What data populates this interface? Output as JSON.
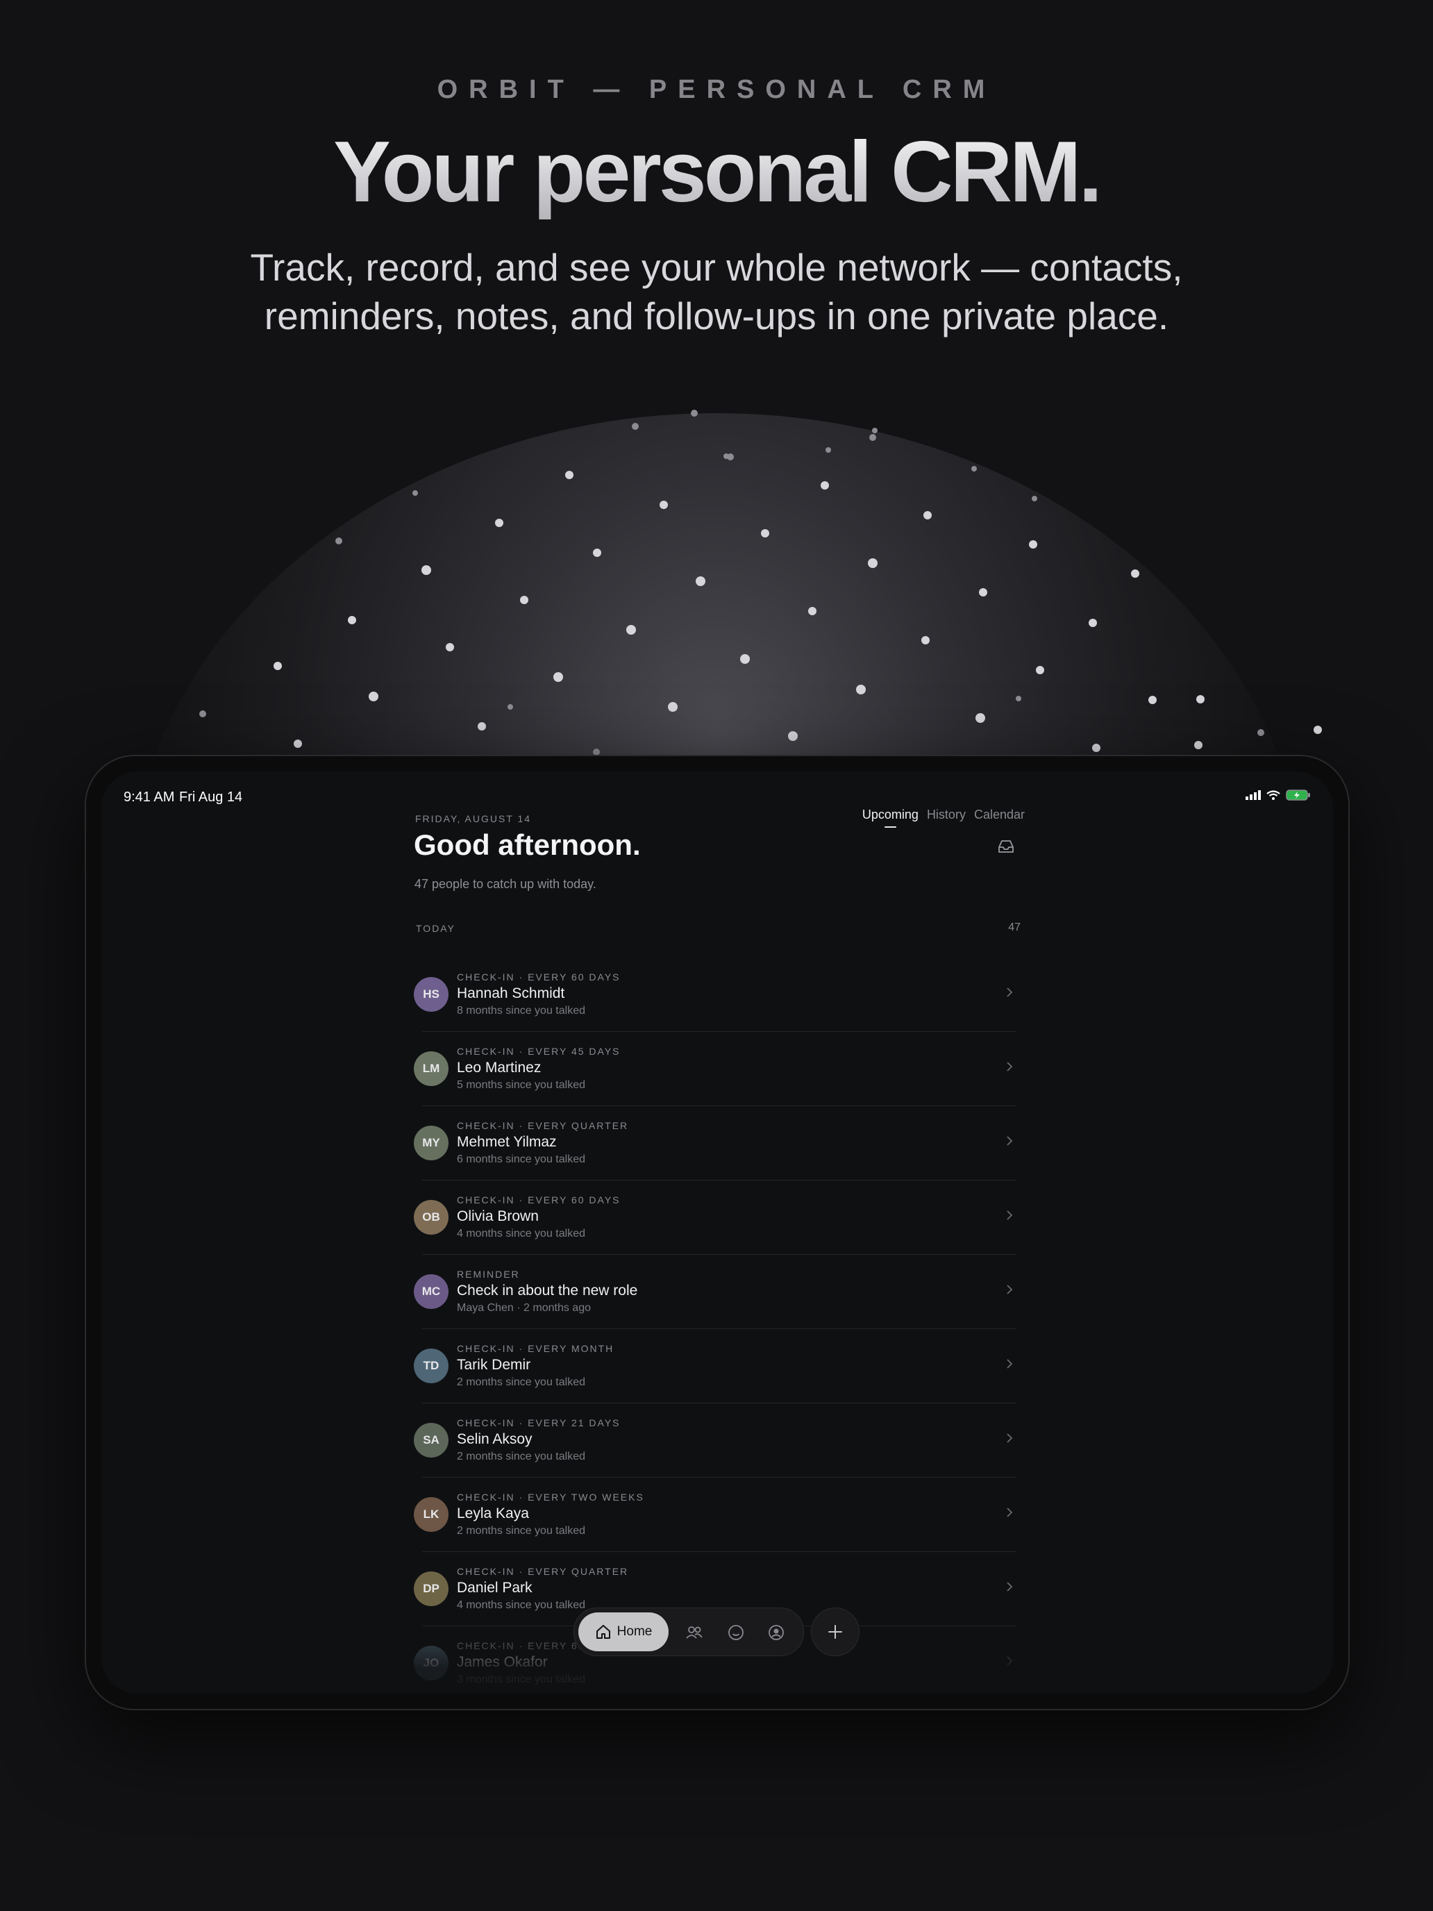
{
  "hero": {
    "eyebrow": "ORBIT — PERSONAL CRM",
    "headline": "Your personal CRM.",
    "subhead_line1": "Track, record, and see your whole network — contacts,",
    "subhead_line2": "reminders, notes, and follow-ups in one private place."
  },
  "status_bar": {
    "time": "9:41 AM",
    "date": "Fri Aug 14",
    "icons": [
      "cellular-icon",
      "wifi-icon",
      "battery-charging-icon"
    ]
  },
  "header": {
    "dateline": "FRIDAY, AUGUST 14",
    "greeting": "Good afternoon.",
    "subtitle": "47 people to catch up with today.",
    "tabs": [
      {
        "label": "Upcoming",
        "active": true
      },
      {
        "label": "History",
        "active": false
      },
      {
        "label": "Calendar",
        "active": false
      }
    ],
    "inbox_icon": "inbox-icon"
  },
  "section": {
    "title": "TODAY",
    "count": "47"
  },
  "items": [
    {
      "initials": "HS",
      "kind": "CHECK-IN · EVERY 60 DAYS",
      "name": "Hannah Schmidt",
      "meta": "8 months since you talked",
      "color": "#6f5f8e"
    },
    {
      "initials": "LM",
      "kind": "CHECK-IN · EVERY 45 DAYS",
      "name": "Leo Martinez",
      "meta": "5 months since you talked",
      "color": "#6b7664"
    },
    {
      "initials": "MY",
      "kind": "CHECK-IN · EVERY QUARTER",
      "name": "Mehmet Yilmaz",
      "meta": "6 months since you talked",
      "color": "#66705f"
    },
    {
      "initials": "OB",
      "kind": "CHECK-IN · EVERY 60 DAYS",
      "name": "Olivia Brown",
      "meta": "4 months since you talked",
      "color": "#7e6c55"
    },
    {
      "initials": "MC",
      "kind": "REMINDER",
      "name": "Check in about the new role",
      "meta": "Maya Chen · 2 months ago",
      "color": "#6b5a87"
    },
    {
      "initials": "TD",
      "kind": "CHECK-IN · EVERY MONTH",
      "name": "Tarik Demir",
      "meta": "2 months since you talked",
      "color": "#4e6676"
    },
    {
      "initials": "SA",
      "kind": "CHECK-IN · EVERY 21 DAYS",
      "name": "Selin Aksoy",
      "meta": "2 months since you talked",
      "color": "#5c6659"
    },
    {
      "initials": "LK",
      "kind": "CHECK-IN · EVERY TWO WEEKS",
      "name": "Leyla Kaya",
      "meta": "2 months since you talked",
      "color": "#6e5746"
    },
    {
      "initials": "DP",
      "kind": "CHECK-IN · EVERY QUARTER",
      "name": "Daniel Park",
      "meta": "4 months since you talked",
      "color": "#6e6546"
    },
    {
      "initials": "JO",
      "kind": "CHECK-IN · EVERY 60 DAYS",
      "name": "James Okafor",
      "meta": "3 months since you talked",
      "color": "#485f6b"
    }
  ],
  "tabbar": {
    "home_label": "Home",
    "icons": [
      "home-icon",
      "people-icon",
      "smile-icon",
      "profile-icon"
    ],
    "fab_icon": "plus-icon"
  }
}
